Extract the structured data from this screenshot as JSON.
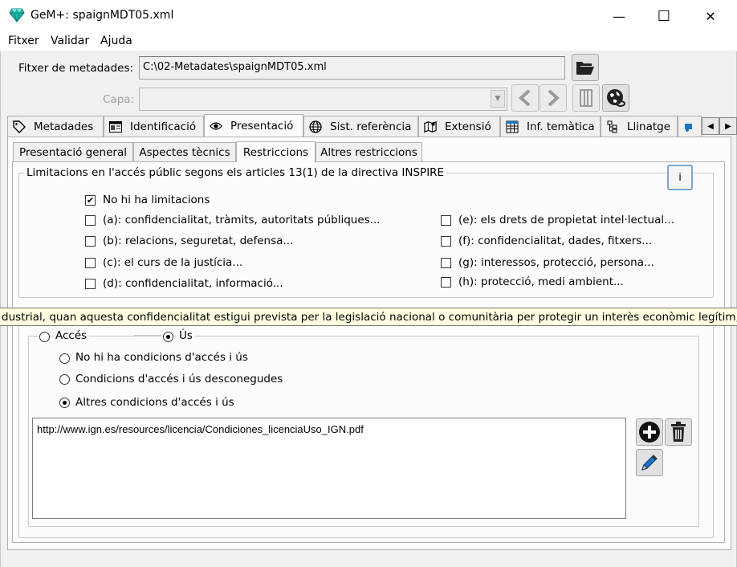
{
  "window": {
    "title": "GeM+: spaignMDT05.xml",
    "app_icon": "diamond-icon",
    "minimize_glyph": "—",
    "maximize_glyph": "☐",
    "close_glyph": "✕"
  },
  "menu": {
    "items": [
      "Fitxer",
      "Validar",
      "Ajuda"
    ]
  },
  "metadata_file": {
    "label": "Fitxer de metadades:",
    "value": "C:\\02-Metadates\\spaignMDT05.xml"
  },
  "capa": {
    "label": "Capa:",
    "value": ""
  },
  "main_tabs": [
    {
      "label": "Metadades",
      "icon": "tag-icon"
    },
    {
      "label": "Identificació",
      "icon": "id-card-icon"
    },
    {
      "label": "Presentació",
      "icon": "eye-icon",
      "active": true
    },
    {
      "label": "Sist. referència",
      "icon": "globe-icon"
    },
    {
      "label": "Extensió",
      "icon": "map-icon"
    },
    {
      "label": "Inf. temàtica",
      "icon": "table-icon"
    },
    {
      "label": "Llinatge",
      "icon": "tree-icon"
    }
  ],
  "sub_tabs": [
    {
      "label": "Presentació general"
    },
    {
      "label": "Aspectes tècnics"
    },
    {
      "label": "Restriccions",
      "active": true
    },
    {
      "label": "Altres restriccions"
    }
  ],
  "limitations": {
    "title": "Limitacions en l'accés públic segons els articles 13(1) de la directiva INSPIRE",
    "info_label": "i",
    "none": {
      "label": "No hi ha limitacions",
      "checked": true
    },
    "left": [
      {
        "label": "(a): confidencialitat, tràmits, autoritats públiques...",
        "checked": false
      },
      {
        "label": "(b): relacions, seguretat, defensa...",
        "checked": false
      },
      {
        "label": "(c): el curs de la justícia...",
        "checked": false
      },
      {
        "label": "(d): confidencialitat, informació...",
        "checked": false
      }
    ],
    "right": [
      {
        "label": "(e): els drets de propietat intel·lectual...",
        "checked": false
      },
      {
        "label": "(f): confidencialitat, dades, fitxers...",
        "checked": false
      },
      {
        "label": "(g): interessos, protecció, persona...",
        "checked": false
      },
      {
        "label": "(h): protecció, medi ambient...",
        "checked": false
      }
    ]
  },
  "tooltip": "dustrial, quan aquesta confidencialitat estigui prevista per la legislació nacional o comunitària per protegir un interès econòmic legítim, incl",
  "conditions": {
    "access_label": "Accés",
    "use_label": "Ús",
    "selected_mode": "Ús",
    "options": [
      {
        "label": "No hi ha condicions d'accés i ús",
        "selected": false
      },
      {
        "label": "Condicions d'accés i ús desconegudes",
        "selected": false
      },
      {
        "label": "Altres condicions d'accés i ús",
        "selected": true
      }
    ],
    "text": "http://www.ign.es/resources/licencia/Condiciones_licenciaUso_IGN.pdf"
  },
  "colors": {
    "accent": "#1a73c8",
    "tooltip_bg": "#ffffe1",
    "panel_bg": "#f0f0f0"
  }
}
